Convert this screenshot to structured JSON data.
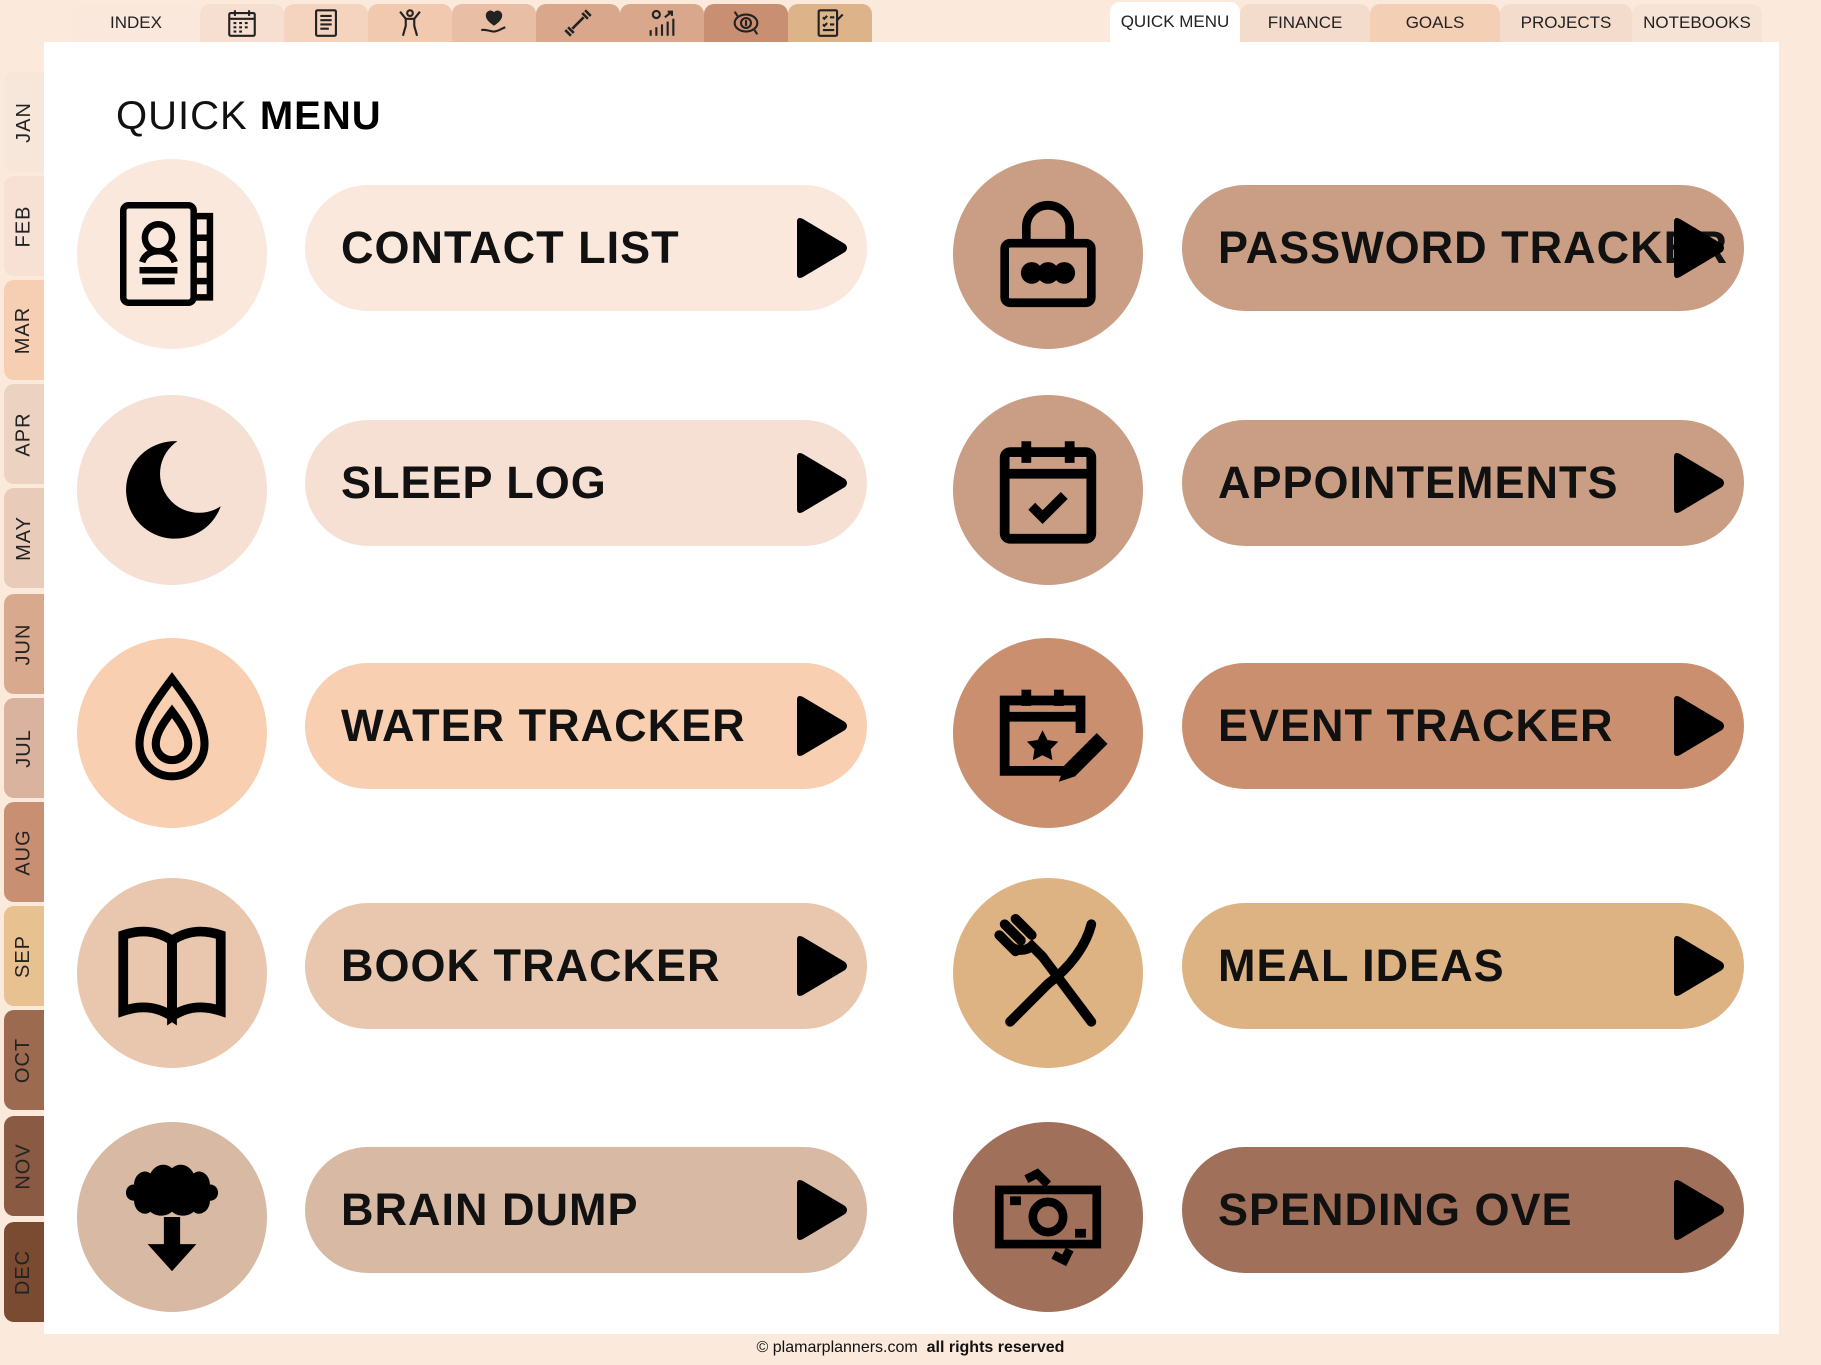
{
  "top_tabs": {
    "index": "INDEX",
    "icon_tabs": [
      {
        "icon": "calendar-icon",
        "color": "#f6dfd0"
      },
      {
        "icon": "notebook-icon",
        "color": "#f5d4bf"
      },
      {
        "icon": "fitness-person-icon",
        "color": "#f0c9ae"
      },
      {
        "icon": "heart-hand-icon",
        "color": "#e8bfa5"
      },
      {
        "icon": "dumbbell-icon",
        "color": "#d8a78c"
      },
      {
        "icon": "growth-chart-icon",
        "color": "#d8a78c"
      },
      {
        "icon": "money-cycle-icon",
        "color": "#c98f72"
      },
      {
        "icon": "checklist-icon",
        "color": "#ddb38a"
      }
    ],
    "right": [
      {
        "label": "QUICK MENU",
        "color": "#ffffff"
      },
      {
        "label": "FINANCE",
        "color": "#f4dccc"
      },
      {
        "label": "GOALS",
        "color": "#f3cfb5"
      },
      {
        "label": "PROJECTS",
        "color": "#f4dccc"
      },
      {
        "label": "NOTEBOOKS",
        "color": "#f6e3d6"
      }
    ]
  },
  "months": [
    {
      "label": "JAN",
      "color": "#f7e6da"
    },
    {
      "label": "FEB",
      "color": "#f6e1d4"
    },
    {
      "label": "MAR",
      "color": "#f6cfb2"
    },
    {
      "label": "APR",
      "color": "#ecd2c1"
    },
    {
      "label": "MAY",
      "color": "#e8cbb9"
    },
    {
      "label": "JUN",
      "color": "#d9a98e"
    },
    {
      "label": "JUL",
      "color": "#d9b39d"
    },
    {
      "label": "AUG",
      "color": "#c98f72"
    },
    {
      "label": "SEP",
      "color": "#e8c191"
    },
    {
      "label": "OCT",
      "color": "#9c6a4f"
    },
    {
      "label": "NOV",
      "color": "#8a5a43"
    },
    {
      "label": "DEC",
      "color": "#7a4b31"
    }
  ],
  "page": {
    "title_light": "QUICK",
    "title_bold": "MENU"
  },
  "menu": [
    {
      "label": "CONTACT LIST",
      "icon": "contact-book-icon",
      "color": "#fae8dc"
    },
    {
      "label": "SLEEP LOG",
      "icon": "moon-icon",
      "color": "#f6e0d3"
    },
    {
      "label": "WATER TRACKER",
      "icon": "water-drop-icon",
      "color": "#f8cfb1"
    },
    {
      "label": "BOOK TRACKER",
      "icon": "open-book-icon",
      "color": "#e8c7ae"
    },
    {
      "label": "BRAIN DUMP",
      "icon": "brain-download-icon",
      "color": "#d8b9a3"
    },
    {
      "label": "PASSWORD TRACKER",
      "icon": "padlock-icon",
      "color": "#c99e85"
    },
    {
      "label": "APPOINTEMENTS",
      "icon": "calendar-check-icon",
      "color": "#c99e85"
    },
    {
      "label": "EVENT TRACKER",
      "icon": "calendar-star-edit-icon",
      "color": "#c98f6f"
    },
    {
      "label": "MEAL IDEAS",
      "icon": "fork-knife-icon",
      "color": "#deb384"
    },
    {
      "label": "SPENDING OVE",
      "icon": "cash-icon",
      "color": "#a0705a"
    }
  ],
  "footer": {
    "site": "© plamarplanners.com",
    "rights": "all rights reserved"
  }
}
